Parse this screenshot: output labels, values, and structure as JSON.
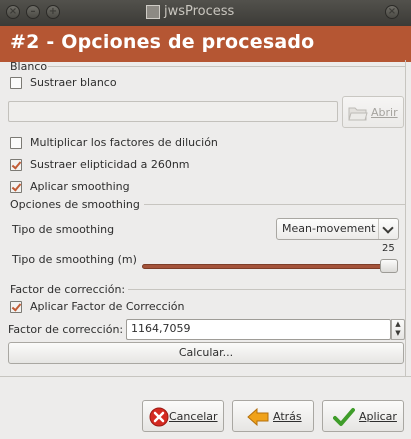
{
  "window": {
    "title": "jwsProcess"
  },
  "header": {
    "title": "#2 - Opciones de procesado"
  },
  "blanco": {
    "group_label": "Blanco",
    "subtract_label": "Sustraer blanco",
    "subtract_checked": false,
    "file_value": "",
    "open_label": "Abrir"
  },
  "options": {
    "multiply_label": "Multiplicar los factores de dilución",
    "multiply_checked": false,
    "ellipticity_label": "Sustraer elipticidad a 260nm",
    "ellipticity_checked": true,
    "smoothing_label": "Aplicar smoothing",
    "smoothing_checked": true
  },
  "smoothing": {
    "group_label": "Opciones de smoothing",
    "type_label": "Tipo de smoothing",
    "type_value": "Mean-movement",
    "window_label": "Tipo de smoothing (m)",
    "window_value": "25",
    "window_max": 25,
    "window_level": 1.0
  },
  "correction": {
    "group_label": "Factor de corrección:",
    "apply_label": "Aplicar Factor de Corrección",
    "apply_checked": true,
    "factor_label": "Factor de corrección:",
    "factor_value": "1164,7059",
    "calc_label": "Calcular..."
  },
  "buttons": {
    "cancel": "Cancelar",
    "back": "Atrás",
    "apply": "Aplicar"
  },
  "colors": {
    "accent": "#b55633",
    "titlebar": "#3c3b37",
    "background": "#edeceb"
  }
}
